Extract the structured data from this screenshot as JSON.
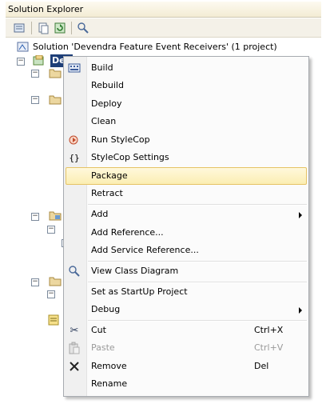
{
  "panel": {
    "title": "Solution Explorer"
  },
  "toolbar": {
    "buttons": [
      {
        "name": "properties-icon"
      },
      {
        "name": "show-all-files-icon"
      },
      {
        "name": "refresh-icon"
      },
      {
        "name": "view-class-diagram-icon"
      }
    ]
  },
  "tree": {
    "solution_label": "Solution 'Devendra Feature Event Receivers' (1 project)",
    "project_label": "Dev"
  },
  "menu": {
    "items": [
      {
        "label": "Build",
        "icon": "build-icon"
      },
      {
        "label": "Rebuild"
      },
      {
        "label": "Deploy"
      },
      {
        "label": "Clean"
      },
      {
        "label": "Run StyleCop",
        "icon": "stylecop-icon"
      },
      {
        "label": "StyleCop Settings",
        "icon": "braces-icon"
      },
      {
        "label": "Package",
        "highlighted": true
      },
      {
        "label": "Retract"
      },
      {
        "label": "Add",
        "submenu": true
      },
      {
        "label": "Add Reference..."
      },
      {
        "label": "Add Service Reference..."
      },
      {
        "label": "View Class Diagram",
        "icon": "class-diagram-icon"
      },
      {
        "label": "Set as StartUp Project"
      },
      {
        "label": "Debug",
        "submenu": true
      },
      {
        "label": "Cut",
        "shortcut": "Ctrl+X",
        "icon": "scissors-icon"
      },
      {
        "label": "Paste",
        "shortcut": "Ctrl+V",
        "icon": "paste-icon",
        "disabled": true
      },
      {
        "label": "Remove",
        "shortcut": "Del",
        "icon": "x-icon"
      },
      {
        "label": "Rename"
      }
    ]
  },
  "colors": {
    "highlight_bg": "#fbeeb2",
    "highlight_border": "#e5c365",
    "selection": "#1e3f78"
  }
}
